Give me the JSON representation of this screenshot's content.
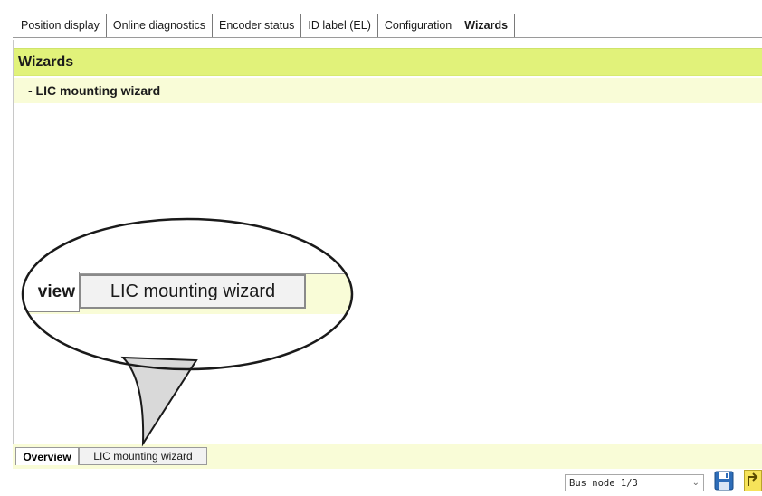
{
  "tabs": [
    {
      "label": "Position display",
      "active": false
    },
    {
      "label": "Online diagnostics",
      "active": false
    },
    {
      "label": "Encoder status",
      "active": false
    },
    {
      "label": "ID label (EL)",
      "active": false
    },
    {
      "label": "Configuration",
      "active": false
    },
    {
      "label": "Wizards",
      "active": true
    }
  ],
  "panel": {
    "title": "Wizards",
    "subtitle": "- LIC mounting wizard"
  },
  "bottom_tabs": {
    "overview": "Overview",
    "lic": "LIC mounting wizard"
  },
  "status": {
    "bus_node": "Bus node 1/3",
    "save_icon": "save-disk-icon",
    "back_icon": "return-arrow-icon"
  },
  "zoom": {
    "overview_partial": "view",
    "lic": "LIC mounting wizard"
  },
  "colors": {
    "header": "#e1f27a",
    "subheader": "#f9fcd7"
  }
}
